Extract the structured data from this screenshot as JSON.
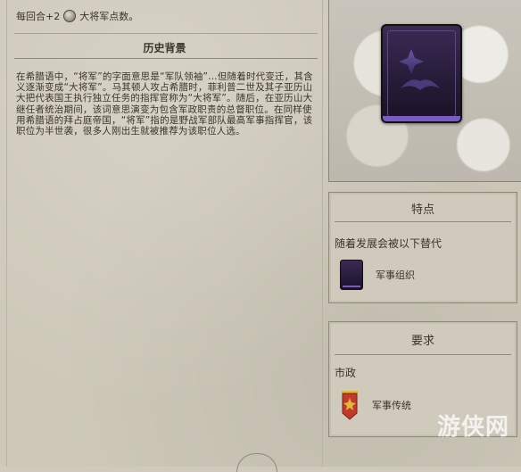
{
  "yield": {
    "prefix": "每回合+2",
    "suffix": "大将军点数。"
  },
  "history": {
    "title": "历史背景",
    "body": "在希腊语中，“将军”的字面意思是“军队领袖”…但随着时代变迁，其含义逐渐变成“大将军”。马其顿人攻占希腊时，菲利普二世及其子亚历山大把代表国王执行独立任务的指挥官称为“大将军”。随后，在亚历山大继任者统治期间，该词意思演变为包含军政职责的总督职位。在同样使用希腊语的拜占庭帝国，“将军”指的是野战军部队最高军事指挥官，该职位为半世袭，很多人刚出生就被推荐为该职位人选。"
  },
  "traits": {
    "title": "特点",
    "replaced_by_label": "随着发展会被以下替代",
    "item_label": "军事组织"
  },
  "requirements": {
    "title": "要求",
    "category_label": "市政",
    "item_label": "军事传统"
  },
  "watermark": "游侠网",
  "icons": {
    "yield": "great-general-coin-icon",
    "card": "policy-card-icon",
    "mini_card": "policy-card-mini-icon",
    "banner": "military-tradition-banner-icon"
  },
  "colors": {
    "card_accent": "#7a5bc5",
    "banner_red": "#c0392b",
    "banner_gold": "#e0b93a"
  }
}
